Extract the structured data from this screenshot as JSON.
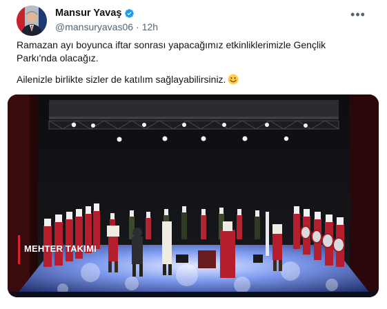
{
  "author": {
    "display_name": "Mansur Yavaş",
    "handle": "@mansuryavas06",
    "time": "12h",
    "separator": "·",
    "verified_icon": "verified-badge-icon",
    "avatar_icon": "profile-photo"
  },
  "menu": {
    "more_label": "•••",
    "icon": "more-icon"
  },
  "tweet": {
    "paragraph1": "Ramazan ayı boyunca iftar sonrası yapacağımız etkinliklerimizle Gençlik Parkı'nda olacağız.",
    "paragraph2": "Ailenizle birlikte sizler de katılım sağlayabilirsiniz.",
    "emoji_icon": "smiling-face-icon"
  },
  "media": {
    "caption": "MEHTER TAKIMI",
    "accent_color": "#d9232d"
  },
  "colors": {
    "verified": "#1d9bf0",
    "text": "#0f1419",
    "muted": "#536471"
  }
}
